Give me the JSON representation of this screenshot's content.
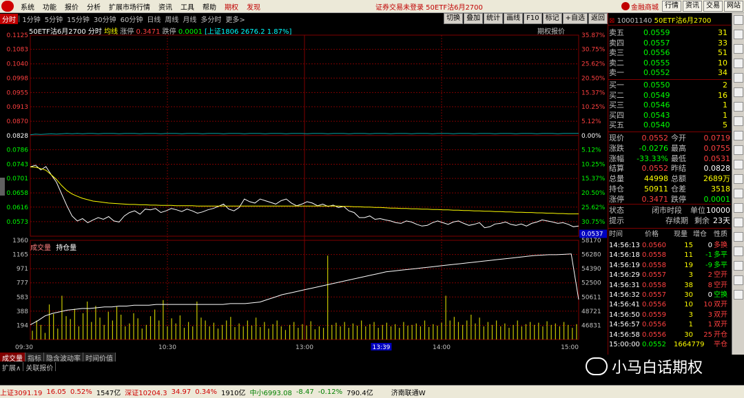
{
  "menu": {
    "items": [
      "系统",
      "功能",
      "报价",
      "分析",
      "扩展市场行情",
      "资讯",
      "工具",
      "帮助"
    ],
    "red_items": [
      "期权",
      "发现"
    ],
    "title": "证券交易未登录  50ETF沽6月2700",
    "brand": "金融商城",
    "right_buttons": [
      "行情",
      "资讯",
      "交易",
      "网站"
    ]
  },
  "periods": {
    "items": [
      "分时",
      "1分钟",
      "5分钟",
      "15分钟",
      "30分钟",
      "60分钟",
      "日线",
      "周线",
      "月线",
      "多分时",
      "更多>"
    ],
    "active": "分时",
    "right_buttons": [
      "切换",
      "叠加",
      "统计",
      "画线",
      "F10",
      "标记",
      "+自选",
      "返回"
    ]
  },
  "chart_header": {
    "name": "50ETF沽6月2700",
    "mode": "分时",
    "avg": "均线",
    "zt_label": "涨停",
    "zt_value": "0.3471",
    "dt_label": "跌停",
    "dt_value": "0.0001",
    "index_info": "[上证1806 2676.2 1.87%]",
    "option_price": "期权报价"
  },
  "chart_data": [
    {
      "type": "line",
      "title": "50ETF沽6月2700",
      "x_ticks": [
        "09:30",
        "10:30",
        "13:00",
        "14:00",
        "15:00"
      ],
      "y_ticks": [
        "0.1125",
        "0.1083",
        "0.1040",
        "0.0998",
        "0.0955",
        "0.0913",
        "0.0870",
        "0.0828",
        "0.0786",
        "0.0743",
        "0.0701",
        "0.0658",
        "0.0616",
        "0.0573"
      ],
      "y_right_ticks": [
        "35.87%",
        "30.75%",
        "25.62%",
        "20.50%",
        "15.37%",
        "10.25%",
        "5.12%",
        "0.00%",
        "5.12%",
        "10.25%",
        "15.37%",
        "20.50%",
        "25.62%",
        "30.75%"
      ],
      "ylim": [
        0.053,
        0.1125
      ],
      "reference": 0.0828,
      "current_marker": "0.0537",
      "series": [
        {
          "name": "价格",
          "color": "#ffffff",
          "values": [
            0.0735,
            0.074,
            0.0726,
            0.0736,
            0.0712,
            0.069,
            0.0655,
            0.062,
            0.059,
            0.0575,
            0.0582,
            0.057,
            0.0578,
            0.0585,
            0.058,
            0.0588,
            0.0575,
            0.0572,
            0.059,
            0.06,
            0.0605,
            0.0595,
            0.061,
            0.0608,
            0.0612,
            0.06,
            0.0605,
            0.0612,
            0.0608,
            0.0603,
            0.061,
            0.0605,
            0.0598,
            0.0602,
            0.0608,
            0.0612,
            0.0618,
            0.0625,
            0.061,
            0.0605,
            0.0615,
            0.064,
            0.0632,
            0.0628,
            0.064,
            0.0635,
            0.063,
            0.0625,
            0.0635,
            0.064,
            0.0628,
            0.062,
            0.0625,
            0.0632,
            0.0628,
            0.062,
            0.0625,
            0.0618,
            0.0622,
            0.0615,
            0.0618,
            0.0605,
            0.06,
            0.0585,
            0.0585,
            0.059,
            0.058,
            0.0582,
            0.0578,
            0.0575,
            0.057,
            0.0568,
            0.0575,
            0.0572,
            0.0565,
            0.056,
            0.0562,
            0.057,
            0.0575,
            0.057,
            0.0565,
            0.0572,
            0.0575,
            0.0568,
            0.0562,
            0.0565,
            0.057,
            0.0555,
            0.0558,
            0.0566,
            0.0568,
            0.0572,
            0.0565,
            0.0562,
            0.0566,
            0.056,
            0.0568,
            0.0572,
            0.0578,
            0.0575,
            0.0572,
            0.0568,
            0.057,
            0.0565,
            0.0558,
            0.056
          ]
        },
        {
          "name": "均线",
          "color": "#ffff00",
          "values": [
            0.0735,
            0.0734,
            0.073,
            0.0725,
            0.0712,
            0.0698,
            0.068,
            0.0665,
            0.0655,
            0.0648,
            0.0642,
            0.0638,
            0.0634,
            0.0632,
            0.063,
            0.0628,
            0.0627,
            0.0626,
            0.0625,
            0.0624,
            0.0624,
            0.0623,
            0.0623,
            0.0622,
            0.0622,
            0.0621,
            0.0621,
            0.0621,
            0.062,
            0.062,
            0.062,
            0.062,
            0.0619,
            0.0619,
            0.0619,
            0.0619,
            0.0619,
            0.0619,
            0.0619,
            0.0619,
            0.0619,
            0.0619,
            0.0619,
            0.0619,
            0.0619,
            0.0619,
            0.0619,
            0.0619,
            0.0619,
            0.0619,
            0.0619,
            0.0619,
            0.0619,
            0.0619,
            0.0619,
            0.0619,
            0.0619,
            0.0619,
            0.0619,
            0.0619,
            0.0618,
            0.0618,
            0.0617,
            0.0617,
            0.0616,
            0.0616,
            0.0615,
            0.0615,
            0.0614,
            0.0613,
            0.0613,
            0.0612,
            0.0612,
            0.0611,
            0.0611,
            0.061,
            0.061,
            0.0609,
            0.0609,
            0.0608,
            0.0608,
            0.0607,
            0.0607,
            0.0606,
            0.0606,
            0.0605,
            0.0605,
            0.0604,
            0.0604,
            0.0603,
            0.0603,
            0.0602,
            0.0602,
            0.0601,
            0.0601,
            0.06,
            0.06,
            0.0599,
            0.0599,
            0.0598,
            0.0598,
            0.0597,
            0.0597,
            0.0596,
            0.0596,
            0.0596
          ]
        },
        {
          "name": "上证",
          "color": "#00a0a0",
          "values": [
            0.083,
            0.0832,
            0.0831,
            0.0832,
            0.0833,
            0.0832,
            0.0833,
            0.0834,
            0.0833,
            0.0834,
            0.0833,
            0.0834,
            0.0834,
            0.0833,
            0.0834,
            0.0834,
            0.0834,
            0.0833,
            0.0834,
            0.0834,
            0.0834,
            0.0833,
            0.0834,
            0.0834,
            0.0834,
            0.0833,
            0.0834,
            0.0834,
            0.0834,
            0.0833,
            0.0834,
            0.0834,
            0.0834,
            0.0833,
            0.0834,
            0.0834,
            0.0834,
            0.0833,
            0.0834,
            0.0834,
            0.0834,
            0.0833,
            0.0834,
            0.0834,
            0.0834,
            0.0833,
            0.0834,
            0.0834,
            0.0834,
            0.0833,
            0.0834,
            0.0834,
            0.0834,
            0.0833,
            0.0834,
            0.0834,
            0.0834,
            0.0833,
            0.0834,
            0.0834,
            0.0834,
            0.0833,
            0.0834,
            0.0834,
            0.0834,
            0.0833,
            0.0834,
            0.0834,
            0.0834,
            0.0833,
            0.0834,
            0.0834,
            0.0834,
            0.0833,
            0.0834,
            0.0834,
            0.0834,
            0.0833,
            0.0834,
            0.0834,
            0.0834,
            0.0833,
            0.0834,
            0.0834,
            0.0834,
            0.0833,
            0.0834,
            0.0834,
            0.0834,
            0.0833,
            0.0834,
            0.0834,
            0.0834,
            0.0833,
            0.0834,
            0.0834,
            0.0834,
            0.0833,
            0.0834,
            0.0834,
            0.0834,
            0.0833,
            0.0834,
            0.0834,
            0.0834,
            0.0834
          ]
        }
      ]
    },
    {
      "type": "bar",
      "title": "成交量",
      "legend": [
        "成交量",
        "持仓量"
      ],
      "y_ticks": [
        "1360",
        "1165",
        "971",
        "777",
        "583",
        "388",
        "194"
      ],
      "y_right_ticks": [
        "58170",
        "56280",
        "54390",
        "52500",
        "50611",
        "48721",
        "46831"
      ],
      "ylim": [
        0,
        1360
      ],
      "oi_lim": [
        46000,
        58170
      ],
      "volume": [
        120,
        260,
        200,
        90,
        480,
        350,
        150,
        600,
        320,
        280,
        420,
        180,
        360,
        520,
        240,
        460,
        300,
        200,
        380,
        260,
        450,
        340,
        180,
        220,
        360,
        290,
        150,
        200,
        320,
        410,
        260,
        540,
        180,
        290,
        220,
        330,
        160,
        240,
        180,
        520,
        300,
        260,
        180,
        230,
        150,
        200,
        260,
        310,
        170,
        220,
        180,
        260,
        190,
        300,
        170,
        240,
        150,
        210,
        260,
        180,
        130,
        200,
        240,
        160,
        210,
        190,
        250,
        140,
        180,
        160,
        1150,
        200,
        230,
        180,
        240,
        160,
        220,
        190,
        260,
        180,
        210,
        240,
        160,
        200,
        230,
        180,
        210,
        160,
        240,
        190,
        200,
        220,
        180,
        260,
        170,
        210,
        190,
        230,
        600,
        260,
        310,
        240,
        200,
        260,
        340,
        220,
        300,
        180,
        240,
        200,
        260,
        180,
        220,
        160,
        200,
        260,
        180,
        210,
        240,
        200,
        230,
        180,
        250,
        200,
        220,
        180,
        240,
        200,
        160,
        210
      ],
      "open_interest": [
        47800,
        48300,
        48900,
        49200,
        49400,
        49600,
        49700,
        49800,
        49800,
        49900,
        50000,
        50000,
        50100,
        50100,
        50200,
        50200,
        50200,
        50300,
        50300,
        50300,
        50300,
        50300,
        50300,
        50300,
        50300,
        50300,
        50300,
        50400,
        50400,
        50400,
        50500,
        50600,
        50900,
        51200,
        51500,
        51700,
        51900,
        52100,
        52300,
        52500,
        52700,
        52900,
        53100,
        53300,
        53500,
        53700,
        53900,
        54100,
        54300,
        54400,
        54500,
        54600,
        54700,
        54800,
        54900,
        55000,
        55100,
        55200,
        55300,
        55400,
        55500,
        55600,
        55700,
        55800,
        55900,
        56000,
        56100,
        56200,
        56300,
        56350,
        56400,
        56400,
        56450,
        56500,
        50900
      ]
    }
  ],
  "quote": {
    "code": "10001140",
    "name": "50ETF沽6月2700",
    "sell": [
      {
        "label": "卖五",
        "price": "0.0559",
        "vol": "31"
      },
      {
        "label": "卖四",
        "price": "0.0557",
        "vol": "33"
      },
      {
        "label": "卖三",
        "price": "0.0556",
        "vol": "51"
      },
      {
        "label": "卖二",
        "price": "0.0555",
        "vol": "10"
      },
      {
        "label": "卖一",
        "price": "0.0552",
        "vol": "34"
      }
    ],
    "buy": [
      {
        "label": "买一",
        "price": "0.0550",
        "vol": "2"
      },
      {
        "label": "买二",
        "price": "0.0549",
        "vol": "16"
      },
      {
        "label": "买三",
        "price": "0.0546",
        "vol": "1"
      },
      {
        "label": "买四",
        "price": "0.0543",
        "vol": "1"
      },
      {
        "label": "买五",
        "price": "0.0540",
        "vol": "5"
      }
    ],
    "info": [
      {
        "l1": "现价",
        "v1": "0.0552",
        "l2": "今开",
        "v2": "0.0719"
      },
      {
        "l1": "涨跌",
        "v1": "-0.0276",
        "l2": "最高",
        "v2": "0.0755"
      },
      {
        "l1": "涨幅",
        "v1": "-33.33%",
        "l2": "最低",
        "v2": "0.0531"
      },
      {
        "l1": "结算",
        "v1": "0.0552",
        "l2": "昨结",
        "v2": "0.0828"
      },
      {
        "l1": "总量",
        "v1": "44998",
        "l2": "总额",
        "v2": "2689万"
      },
      {
        "l1": "持仓",
        "v1": "50911",
        "l2": "仓差",
        "v2": "3518"
      },
      {
        "l1": "涨停",
        "v1": "0.3471",
        "l2": "跌停",
        "v2": "0.0001"
      }
    ],
    "status": {
      "l1": "状态",
      "v1": "闭市时段",
      "l2": "单位",
      "v2": "10000"
    },
    "hint": {
      "l1": "提示",
      "v1": "存续期",
      "l2": "剩余",
      "v2": "23天"
    },
    "tick_headers": [
      "时间",
      "价格",
      "现量",
      "增仓",
      "性质"
    ],
    "ticks": [
      {
        "t": "14:56:13",
        "p": "0.0560",
        "v": "15",
        "d": "0",
        "n": "多换"
      },
      {
        "t": "14:56:18",
        "p": "0.0558",
        "v": "11",
        "d": "-1",
        "n": "多平"
      },
      {
        "t": "14:56:19",
        "p": "0.0558",
        "v": "19",
        "d": "-9",
        "n": "多平"
      },
      {
        "t": "14:56:29",
        "p": "0.0557",
        "v": "3",
        "d": "2",
        "n": "空开"
      },
      {
        "t": "14:56:31",
        "p": "0.0558",
        "v": "38",
        "d": "8",
        "n": "空开"
      },
      {
        "t": "14:56:32",
        "p": "0.0557",
        "v": "30",
        "d": "0",
        "n": "空换"
      },
      {
        "t": "14:56:41",
        "p": "0.0556",
        "v": "10",
        "d": "10",
        "n": "双开"
      },
      {
        "t": "14:56:50",
        "p": "0.0559",
        "v": "3",
        "d": "3",
        "n": "双开"
      },
      {
        "t": "14:56:57",
        "p": "0.0556",
        "v": "1",
        "d": "1",
        "n": "双开"
      },
      {
        "t": "14:56:58",
        "p": "0.0556",
        "v": "30",
        "d": "25",
        "n": "开仓"
      },
      {
        "t": "15:00:00",
        "p": "0.0552",
        "v": "1664779",
        "d": "",
        "n": "平仓"
      }
    ]
  },
  "bottom_tabs": [
    "成交量",
    "指标",
    "隐含波动率",
    "时间价值"
  ],
  "bottom_tabs2": [
    "扩展∧",
    "关联报价"
  ],
  "time_marker": "13:39",
  "watermark": "小马白话期权",
  "statusbar": {
    "sh": "上证3091.19",
    "sh_chg": "16.05",
    "sh_pct": "0.52%",
    "sh_amt": "1547亿",
    "sz": "深证10204.3",
    "sz_chg": "34.97",
    "sz_pct": "0.34%",
    "sz_amt": "1910亿",
    "zx": "中小6993.08",
    "zx_chg": "-8.47",
    "zx_pct": "-0.12%",
    "zx_amt": "790.4亿",
    "broker": "济南联通W"
  }
}
